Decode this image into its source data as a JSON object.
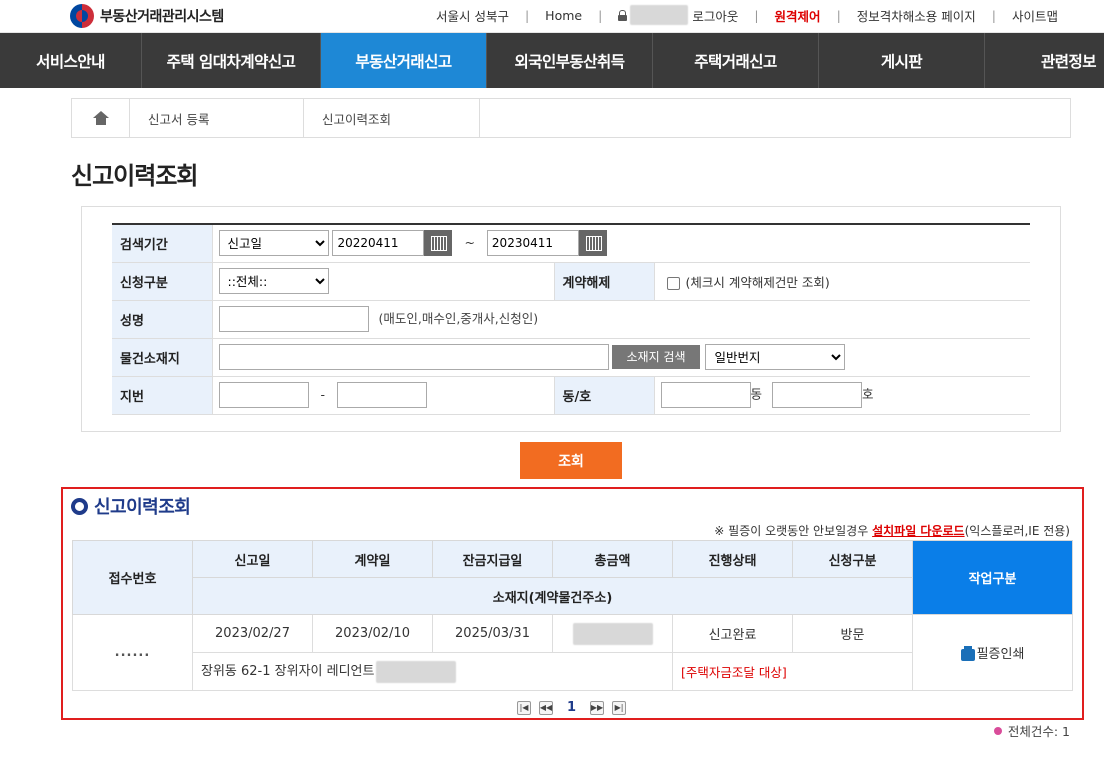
{
  "header": {
    "logo_text": "부동산거래관리시스템",
    "links": {
      "region": "서울시 성북구",
      "home": "Home",
      "logout": "로그아웃",
      "remote": "원격제어",
      "info": "정보격차해소용 페이지",
      "sitemap": "사이트맵"
    }
  },
  "nav": {
    "items": [
      {
        "label": "서비스안내"
      },
      {
        "label": "주택 임대차계약신고"
      },
      {
        "label": "부동산거래신고"
      },
      {
        "label": "외국인부동산취득"
      },
      {
        "label": "주택거래신고"
      },
      {
        "label": "게시판"
      },
      {
        "label": "관련정보"
      }
    ]
  },
  "breadcrumb": {
    "items": [
      "신고서 등록",
      "신고이력조회"
    ]
  },
  "page_title": "신고이력조회",
  "search": {
    "period_label": "검색기간",
    "period_type": "신고일",
    "date_from": "20220411",
    "date_tilde": "~",
    "date_to": "20230411",
    "apply_type_label": "신청구분",
    "apply_type_value": "::전체::",
    "cancel_label": "계약해제",
    "cancel_hint": "(체크시 계약해제건만 조회)",
    "name_label": "성명",
    "name_hint": "(매도인,매수인,중개사,신청인)",
    "location_label": "물건소재지",
    "location_search_button": "소재지 검색",
    "lot_type": "일반번지",
    "lot_label": "지번",
    "lot_dash": "-",
    "dongho_label": "동/호",
    "dong_suffix": "동",
    "ho_suffix": "호",
    "submit_label": "조회"
  },
  "results": {
    "title": "신고이력조회",
    "notice_prefix": "※ 필증이 오랫동안 안보일경우",
    "notice_link": "설치파일 다운로드",
    "notice_suffix": "(익스플로러,IE 전용)",
    "headers": {
      "receipt_no": "접수번호",
      "report_date": "신고일",
      "contract_date": "계약일",
      "balance_date": "잔금지급일",
      "total_amount": "총금액",
      "status": "진행상태",
      "apply_type": "신청구분",
      "location": "소재지(계약물건주소)",
      "action": "작업구분"
    },
    "rows": [
      {
        "receipt_no": "......",
        "report_date": "2023/02/27",
        "contract_date": "2023/02/10",
        "balance_date": "2025/03/31",
        "status": "신고완료",
        "apply_type": "방문",
        "address": "장위동 62-1 장위자이 레디언트",
        "flag": "[주택자금조달 대상]",
        "action": "필증인쇄"
      }
    ],
    "pager": {
      "current": "1"
    },
    "total": "전체건수: 1"
  }
}
